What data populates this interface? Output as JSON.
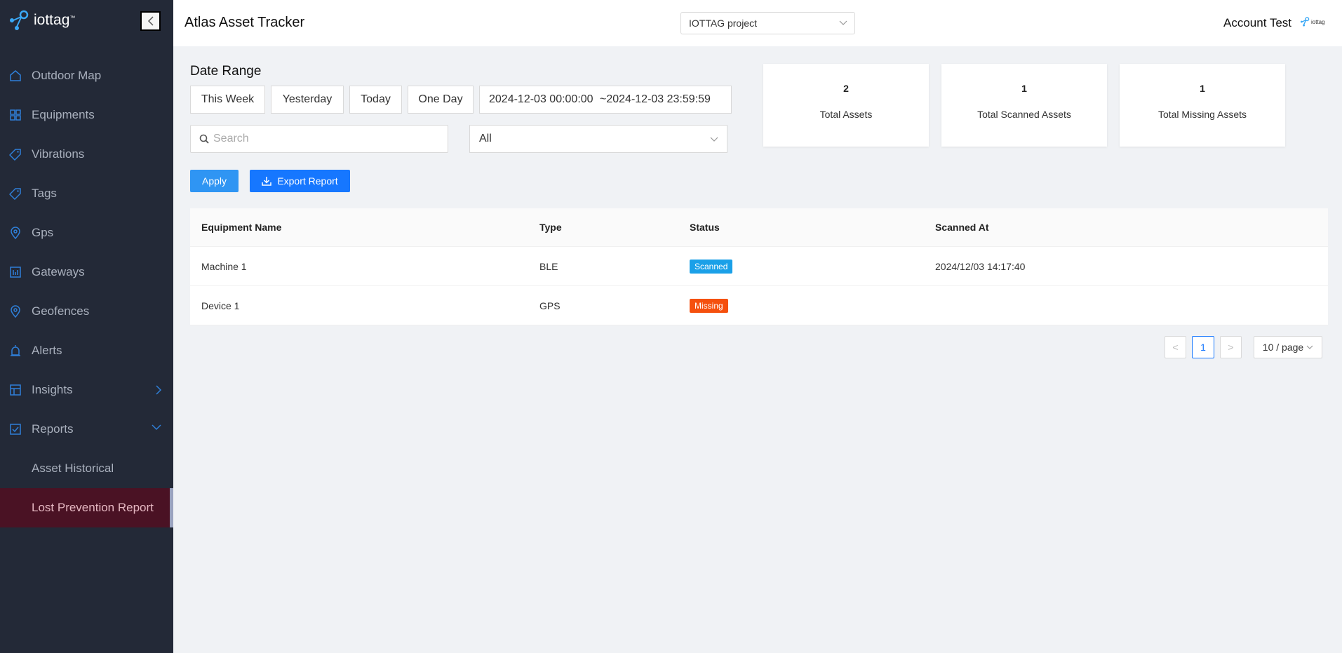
{
  "sidebar": {
    "logo_text": "iottag",
    "logo_tm": "™",
    "items": [
      {
        "label": "Outdoor Map"
      },
      {
        "label": "Equipments"
      },
      {
        "label": "Vibrations"
      },
      {
        "label": "Tags"
      },
      {
        "label": "Gps"
      },
      {
        "label": "Gateways"
      },
      {
        "label": "Geofences"
      },
      {
        "label": "Alerts"
      },
      {
        "label": "Insights"
      },
      {
        "label": "Reports"
      },
      {
        "label": "Asset Historical"
      },
      {
        "label": "Lost Prevention Report"
      }
    ]
  },
  "header": {
    "title": "Atlas Asset Tracker",
    "project": "IOTTAG project",
    "account": "Account Test",
    "mini_logo_text": "iottag"
  },
  "filters": {
    "date_range_title": "Date Range",
    "quick_ranges": [
      "This Week",
      "Yesterday",
      "Today",
      "One Day"
    ],
    "date_start": "2024-12-03 00:00:00",
    "date_separator": "~",
    "date_end": "2024-12-03 23:59:59",
    "search_placeholder": "Search",
    "select_value": "All",
    "apply_label": "Apply",
    "export_label": "Export Report"
  },
  "stats": [
    {
      "value": "2",
      "label": "Total Assets"
    },
    {
      "value": "1",
      "label": "Total Scanned Assets"
    },
    {
      "value": "1",
      "label": "Total Missing Assets"
    }
  ],
  "table": {
    "columns": [
      "Equipment Name",
      "Type",
      "Status",
      "Scanned At"
    ],
    "rows": [
      {
        "name": "Machine 1",
        "type": "BLE",
        "status": "Scanned",
        "scanned_at": "2024/12/03 14:17:40"
      },
      {
        "name": "Device 1",
        "type": "GPS",
        "status": "Missing",
        "scanned_at": ""
      }
    ]
  },
  "pagination": {
    "prev": "<",
    "current": "1",
    "next": ">",
    "page_size": "10 / page"
  },
  "colors": {
    "sidebar_bg": "#232937",
    "accent": "#1677ff",
    "scanned": "#1aa0e8",
    "missing": "#f5500e",
    "active_nav": "#4a1224"
  }
}
